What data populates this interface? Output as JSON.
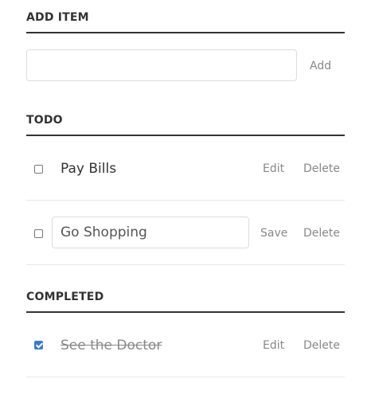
{
  "add_section": {
    "title": "ADD ITEM",
    "input_value": "",
    "add_label": "Add"
  },
  "todo_section": {
    "title": "TODO",
    "items": [
      {
        "label": "Pay Bills",
        "checked": false,
        "editing": false,
        "edit_label": "Edit",
        "delete_label": "Delete"
      },
      {
        "label": "Go Shopping",
        "checked": false,
        "editing": true,
        "edit_value": "Go Shopping",
        "save_label": "Save",
        "delete_label": "Delete"
      }
    ]
  },
  "completed_section": {
    "title": "COMPLETED",
    "items": [
      {
        "label": "See the Doctor",
        "checked": true,
        "editing": false,
        "edit_label": "Edit",
        "delete_label": "Delete"
      }
    ]
  },
  "colors": {
    "text": "#333333",
    "muted": "#888888",
    "divider": "#e8e8e8",
    "checkbox_checked": "#3a7bd5"
  }
}
